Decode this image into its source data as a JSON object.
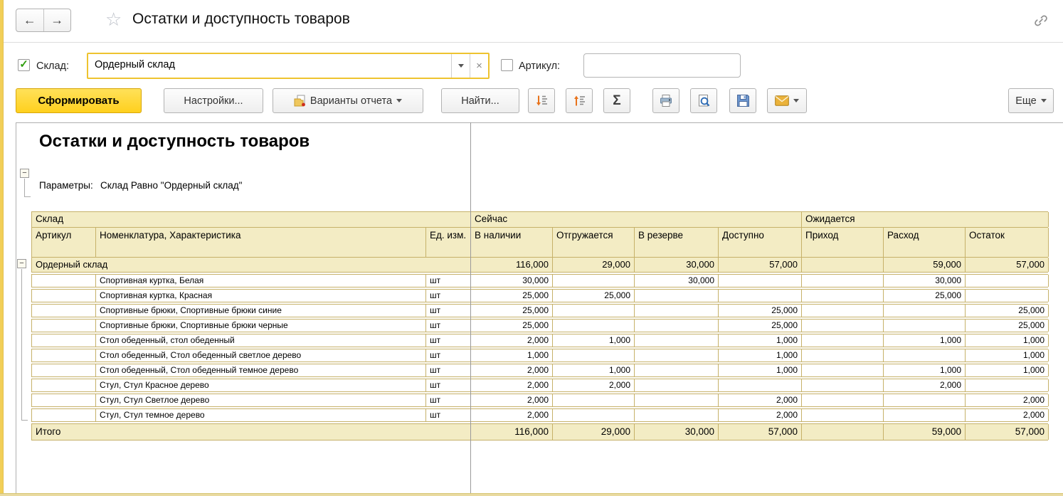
{
  "topbar": {
    "title": "Остатки и доступность товаров"
  },
  "icons": {
    "back_arrow": "←",
    "forward_arrow": "→",
    "favorite_star": "☆",
    "link": "link-chain",
    "check": "✓",
    "dropdown_caret": "▾",
    "clear": "×",
    "minus_expander": "−"
  },
  "filters": {
    "sklad_checked": true,
    "sklad_label": "Склад:",
    "sklad_value": "Ордерный склад",
    "artikul_checked": false,
    "artikul_label": "Артикул:",
    "artikul_value": ""
  },
  "toolbar": {
    "generate": "Сформировать",
    "settings": "Настройки...",
    "variants": "Варианты отчета",
    "find": "Найти...",
    "sigma": "Σ",
    "more": "Еще"
  },
  "report": {
    "title": "Остатки и доступность товаров",
    "params_label": "Параметры:",
    "params_value": "Склад Равно \"Ордерный склад\"",
    "table": {
      "group_headers": [
        "Склад",
        "Сейчас",
        "Ожидается"
      ],
      "columns": [
        "Артикул",
        "Номенклатура, Характеристика",
        "Ед. изм.",
        "В наличии",
        "Отгружается",
        "В резерве",
        "Доступно",
        "Приход",
        "Расход",
        "Остаток"
      ],
      "group_row": {
        "label": "Ордерный склад",
        "values": [
          "116,000",
          "29,000",
          "30,000",
          "57,000",
          "",
          "59,000",
          "57,000"
        ]
      },
      "rows": [
        {
          "artikul": "",
          "name": "Спортивная куртка, Белая",
          "unit": "шт",
          "values": [
            "30,000",
            "",
            "30,000",
            "",
            "",
            "30,000",
            ""
          ]
        },
        {
          "artikul": "",
          "name": "Спортивная куртка, Красная",
          "unit": "шт",
          "values": [
            "25,000",
            "25,000",
            "",
            "",
            "",
            "25,000",
            ""
          ]
        },
        {
          "artikul": "",
          "name": "Спортивные брюки, Спортивные брюки синие",
          "unit": "шт",
          "values": [
            "25,000",
            "",
            "",
            "25,000",
            "",
            "",
            "25,000"
          ]
        },
        {
          "artikul": "",
          "name": "Спортивные брюки, Спортивные брюки черные",
          "unit": "шт",
          "values": [
            "25,000",
            "",
            "",
            "25,000",
            "",
            "",
            "25,000"
          ]
        },
        {
          "artikul": "",
          "name": "Стол обеденный, стол обеденный",
          "unit": "шт",
          "values": [
            "2,000",
            "1,000",
            "",
            "1,000",
            "",
            "1,000",
            "1,000"
          ]
        },
        {
          "artikul": "",
          "name": "Стол обеденный, Стол обеденный светлое дерево",
          "unit": "шт",
          "values": [
            "1,000",
            "",
            "",
            "1,000",
            "",
            "",
            "1,000"
          ]
        },
        {
          "artikul": "",
          "name": "Стол обеденный, Стол обеденный темное дерево",
          "unit": "шт",
          "values": [
            "2,000",
            "1,000",
            "",
            "1,000",
            "",
            "1,000",
            "1,000"
          ]
        },
        {
          "artikul": "",
          "name": "Стул, Стул Красное дерево",
          "unit": "шт",
          "values": [
            "2,000",
            "2,000",
            "",
            "",
            "",
            "2,000",
            ""
          ]
        },
        {
          "artikul": "",
          "name": "Стул, Стул Светлое дерево",
          "unit": "шт",
          "values": [
            "2,000",
            "",
            "",
            "2,000",
            "",
            "",
            "2,000"
          ]
        },
        {
          "artikul": "",
          "name": "Стул, Стул темное дерево",
          "unit": "шт",
          "values": [
            "2,000",
            "",
            "",
            "2,000",
            "",
            "",
            "2,000"
          ]
        }
      ],
      "total_row": {
        "label": "Итого",
        "values": [
          "116,000",
          "29,000",
          "30,000",
          "57,000",
          "",
          "59,000",
          "57,000"
        ]
      }
    }
  },
  "colors": {
    "accent_yellow": "#ffd21e",
    "focus_border": "#eec32f",
    "table_header_bg": "#f3ecc4",
    "table_border": "#c6b169",
    "page_break_line": "#9a9a9a",
    "left_strip": "#f2cf58"
  }
}
